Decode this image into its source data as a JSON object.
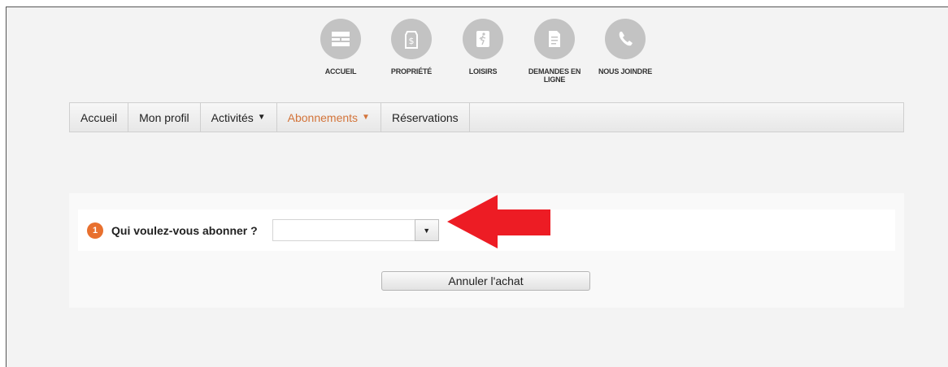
{
  "topnav": [
    {
      "label": "ACCUEIL",
      "icon": "home-grid-icon"
    },
    {
      "label": "PROPRIÉTÉ",
      "icon": "property-tag-icon"
    },
    {
      "label": "LOISIRS",
      "icon": "leisure-runner-icon"
    },
    {
      "label": "DEMANDES EN LIGNE",
      "icon": "document-icon"
    },
    {
      "label": "NOUS JOINDRE",
      "icon": "phone-icon"
    }
  ],
  "menu": [
    {
      "label": "Accueil",
      "caret": ""
    },
    {
      "label": "Mon profil",
      "caret": ""
    },
    {
      "label": "Activités",
      "caret": "▼"
    },
    {
      "label": "Abonnements",
      "caret": "▼"
    },
    {
      "label": "Réservations",
      "caret": ""
    }
  ],
  "form": {
    "step_number": "1",
    "question": "Qui voulez-vous abonner ?",
    "select_value": "",
    "select_caret": "▼",
    "cancel_label": "Annuler l'achat"
  },
  "colors": {
    "accent": "#e8702e",
    "active_menu": "#d3743a",
    "annotation_arrow": "#ed1c24",
    "icon_circle": "#c3c3c3"
  }
}
